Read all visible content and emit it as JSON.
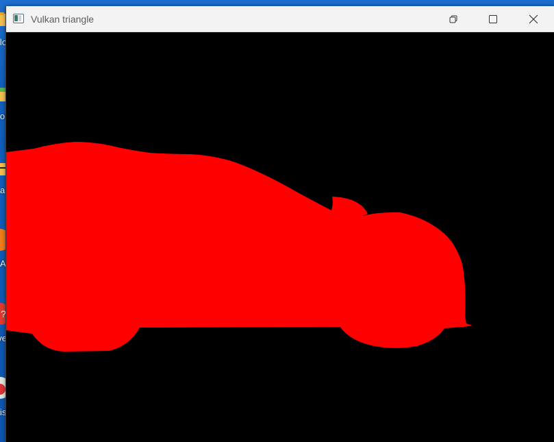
{
  "window": {
    "title": "Vulkan triangle",
    "buttons": {
      "restore": "restore-icon",
      "maximize": "maximize-icon",
      "close": "close-icon"
    }
  },
  "desktop": {
    "icon_labels": [
      "lo",
      "oi",
      "a",
      "A",
      "ve",
      "is"
    ]
  },
  "render": {
    "clear_color": "#000000",
    "shape_color": "#ff0000",
    "shape": "car-silhouette"
  }
}
